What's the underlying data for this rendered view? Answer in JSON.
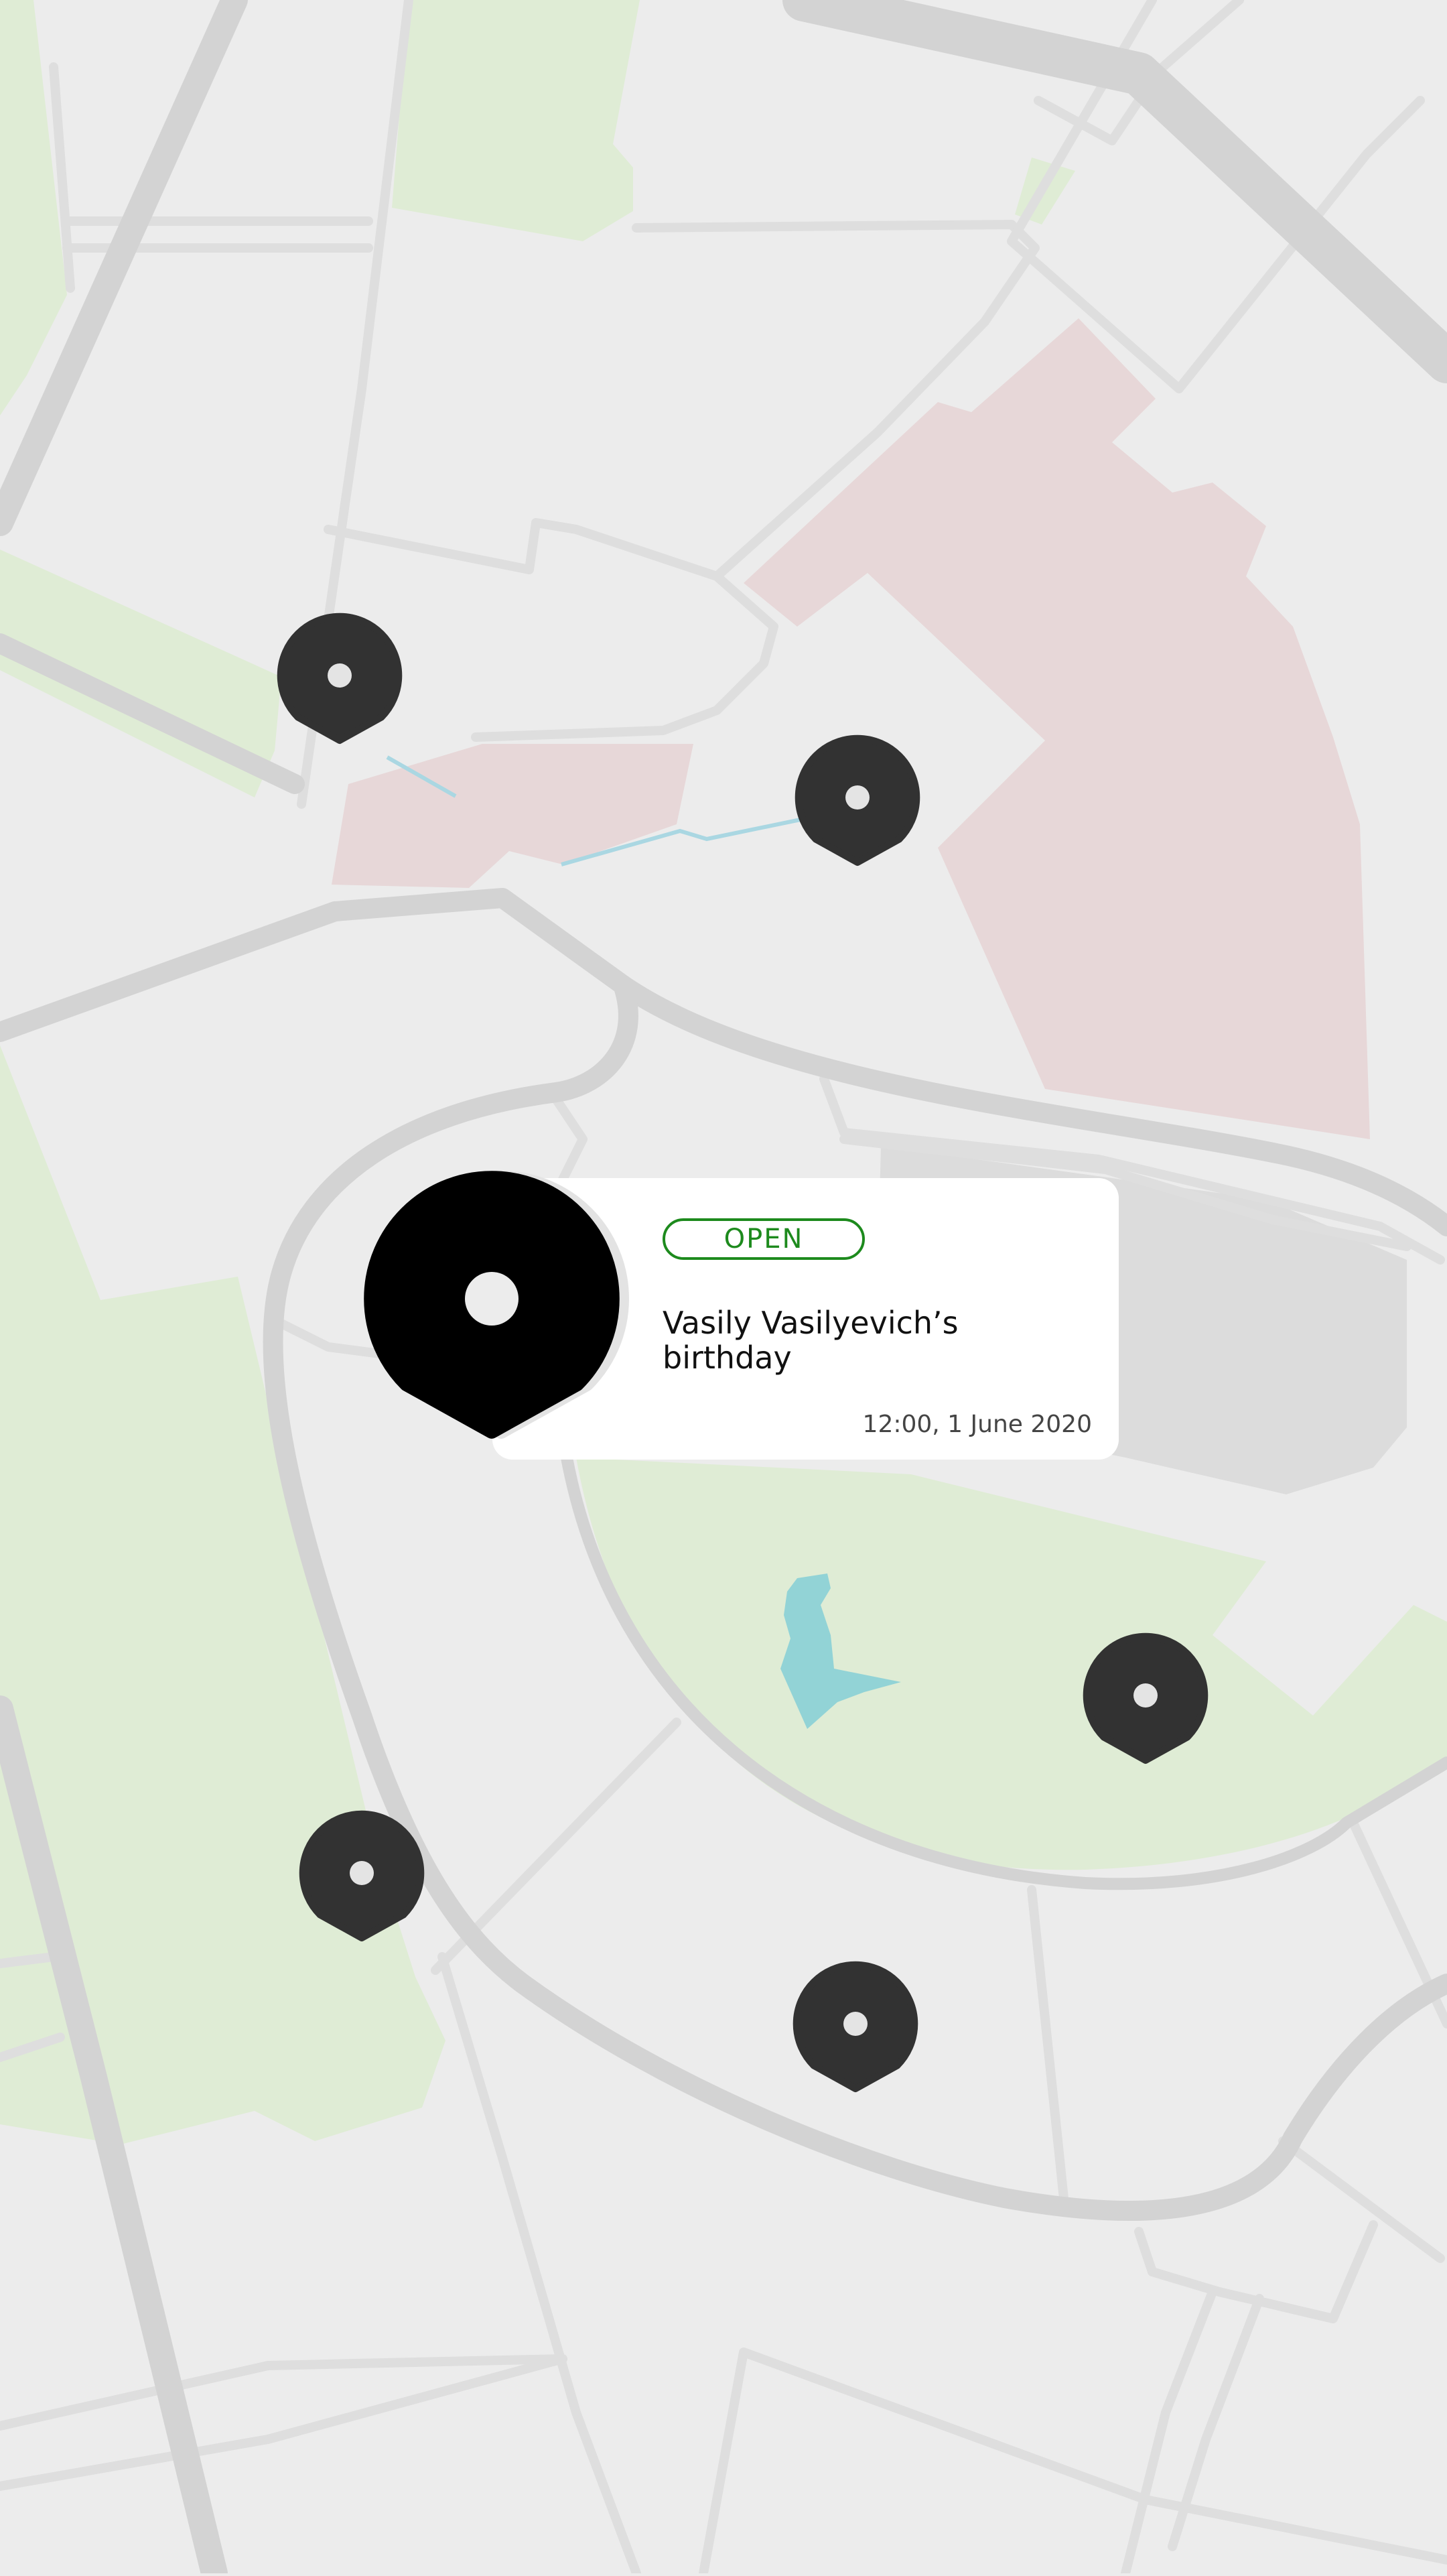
{
  "colors": {
    "background": "#ececec",
    "park": "#dfecd5",
    "building_pink": "#e7d7d8",
    "building_gray": "#dcdcdc",
    "water": "#92d3d6",
    "road_major": "#d3d3d3",
    "road_minor": "#dedede",
    "pin": "#323232",
    "pin_selected": "#000000",
    "status_green": "#1d8a1d"
  },
  "map": {
    "pins": [
      {
        "name": "map-pin-northwest",
        "icon": "location-pin-icon"
      },
      {
        "name": "map-pin-north-center",
        "icon": "location-pin-icon"
      },
      {
        "name": "map-pin-east",
        "icon": "location-pin-icon"
      },
      {
        "name": "map-pin-southwest",
        "icon": "location-pin-icon"
      },
      {
        "name": "map-pin-south",
        "icon": "location-pin-icon"
      }
    ],
    "selected_pin": {
      "name": "selected-map-pin",
      "icon": "location-pin-icon"
    }
  },
  "event_card": {
    "status": "OPEN",
    "title": "Vasily Vasilyevich’s birthday",
    "datetime": "12:00, 1 June 2020"
  }
}
